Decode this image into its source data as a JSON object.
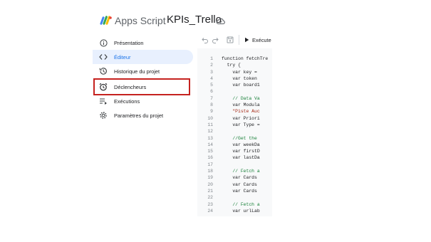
{
  "header": {
    "app_name": "Apps Script",
    "project_name": "KPIs_Trello",
    "save_status_icon": "cloud-done-icon"
  },
  "sidebar": {
    "items": [
      {
        "label": "Présentation",
        "icon": "info-icon"
      },
      {
        "label": "Éditeur",
        "icon": "code-icon"
      },
      {
        "label": "Historique du projet",
        "icon": "history-icon"
      },
      {
        "label": "Déclencheurs",
        "icon": "alarm-icon"
      },
      {
        "label": "Exécutions",
        "icon": "executions-icon"
      },
      {
        "label": "Paramètres du projet",
        "icon": "gear-icon"
      }
    ],
    "active_index": 1,
    "highlighted_index": 3
  },
  "toolbar": {
    "run_label": "Exécute"
  },
  "editor": {
    "line_numbers": [
      "1",
      "2",
      "3",
      "4",
      "5",
      "6",
      "7",
      "8",
      "9",
      "10",
      "11",
      "12",
      "13",
      "14",
      "15",
      "16",
      "17",
      "18",
      "19",
      "20",
      "21",
      "22",
      "23",
      "24"
    ],
    "lines": [
      "function fetchTre",
      "  try {",
      "    var key =",
      "    var token",
      "    var board1",
      "",
      "    // Data Va",
      "    var Modula",
      "    \"Piste Auc",
      "    var Priori",
      "    var Type =",
      "",
      "    //Get the",
      "    var weekDa",
      "    var firstD",
      "    var lastDa",
      "",
      "    // Fetch a",
      "    var Cards",
      "    var Cards",
      "    var Cards",
      "",
      "    // Fetch a",
      "    var urlLab"
    ]
  },
  "colors": {
    "accent": "#1a73e8",
    "active_bg": "#e8f0fe",
    "highlight_border": "#c5221f",
    "comment": "#188038",
    "string": "#a52714"
  }
}
